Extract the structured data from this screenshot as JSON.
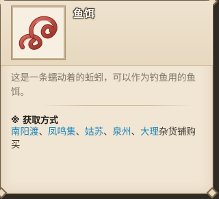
{
  "item": {
    "name": "鱼饵",
    "icon": "worm-icon",
    "description": "这是一条蠕动着的蚯蚓，可以作为钓鱼用的鱼饵。"
  },
  "acquisition": {
    "title": "※ 获取方式",
    "places": [
      "南阳渡",
      "凤鸣集",
      "姑苏",
      "泉州",
      "大理"
    ],
    "separator": "、",
    "suffix": "杂货铺购买"
  },
  "colors": {
    "panel": "#f1e6d3",
    "link": "#1d86bf",
    "description": "#7d7468"
  }
}
